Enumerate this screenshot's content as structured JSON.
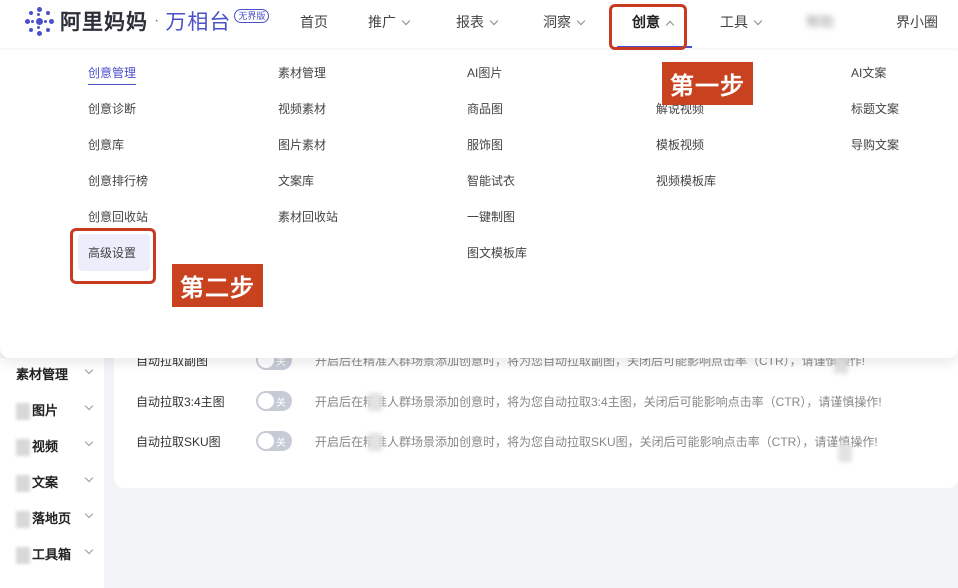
{
  "logo": {
    "brand": "阿里妈妈",
    "dot": "·",
    "product": "万相台",
    "badge": "无界版"
  },
  "nav": {
    "items": [
      {
        "label": "首页"
      },
      {
        "label": "推广"
      },
      {
        "label": "报表"
      },
      {
        "label": "洞察"
      },
      {
        "label": "创意"
      },
      {
        "label": "工具"
      },
      {
        "label": "帮助"
      },
      {
        "label": "界小圈"
      }
    ]
  },
  "dropdown": {
    "col1": [
      "创意管理",
      "创意诊断",
      "创意库",
      "创意排行榜",
      "创意回收站",
      "高级设置"
    ],
    "col2": [
      "素材管理",
      "视频素材",
      "图片素材",
      "文案库",
      "素材回收站"
    ],
    "col3": [
      "AI图片",
      "商品图",
      "服饰图",
      "智能试衣",
      "一键制图",
      "图文模板库"
    ],
    "col4": [
      "解说视频",
      "模板视频",
      "视频模板库"
    ],
    "col5": [
      "AI文案",
      "标题文案",
      "导购文案"
    ]
  },
  "annotations": {
    "step1": "第一步",
    "step2": "第二步"
  },
  "sidebar": {
    "items": [
      {
        "label": "素材管理"
      },
      {
        "label": "图片"
      },
      {
        "label": "视频"
      },
      {
        "label": "文案"
      },
      {
        "label": "落地页"
      },
      {
        "label": "工具箱"
      }
    ]
  },
  "settings": {
    "toggle_off_label": "关",
    "rows": [
      {
        "label": "自动拉取副图",
        "desc": "开启后在精准人群场景添加创意时，将为您自动拉取副图，关闭后可能影响点击率（CTR），请谨慎操作!"
      },
      {
        "label": "自动拉取3:4主图",
        "desc": "开启后在精准人群场景添加创意时，将为您自动拉取3:4主图，关闭后可能影响点击率（CTR），请谨慎操作!"
      },
      {
        "label": "自动拉取SKU图",
        "desc": "开启后在精准人群场景添加创意时，将为您自动拉取SKU图，关闭后可能影响点击率（CTR），请谨慎操作!"
      }
    ]
  },
  "colors": {
    "accent": "#4a51c8",
    "annotation": "#c8421f"
  }
}
